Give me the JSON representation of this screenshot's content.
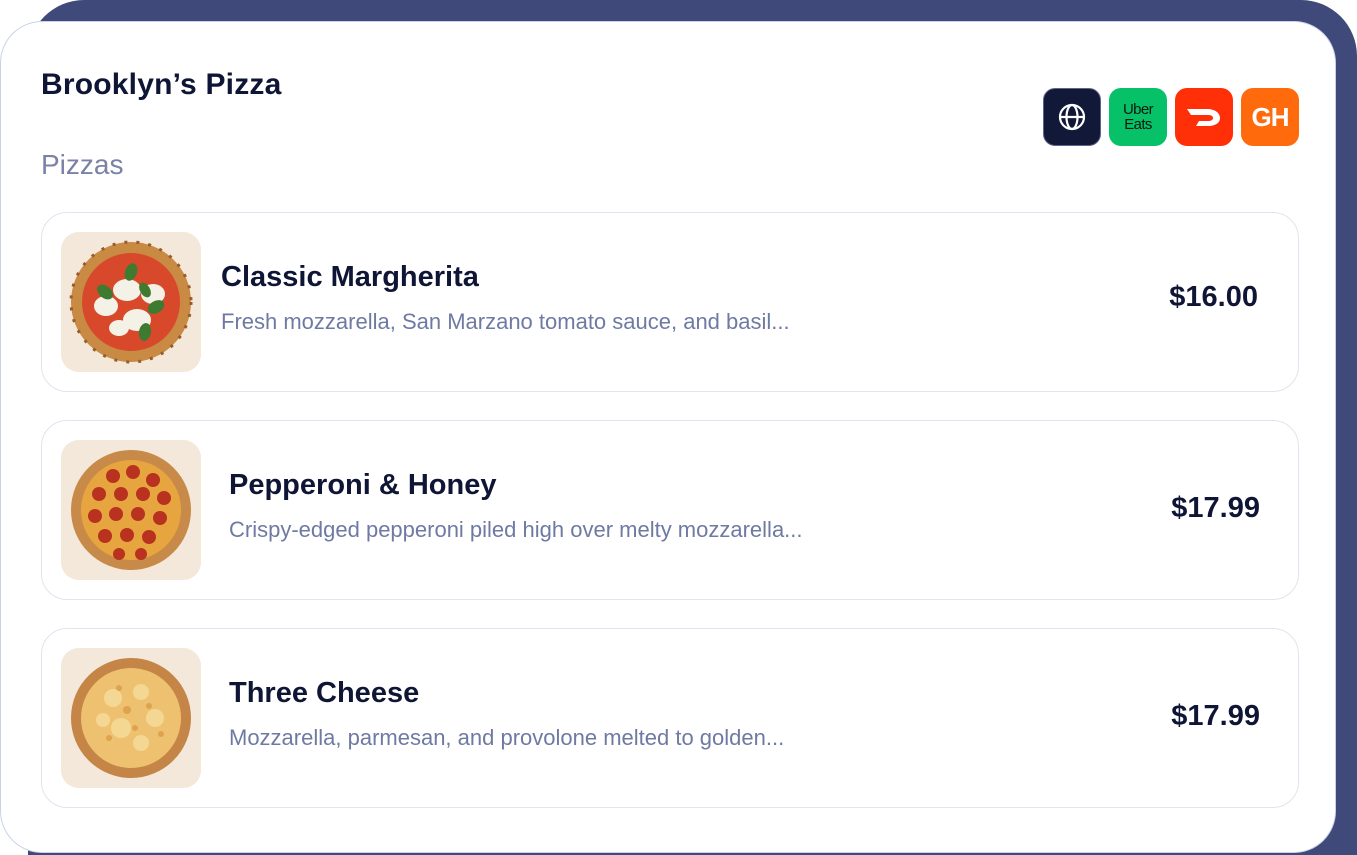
{
  "restaurant": {
    "name": "Brooklyn’s Pizza"
  },
  "category": "Pizzas",
  "links": [
    {
      "label": "",
      "icon": "globe-icon"
    },
    {
      "label_line1": "Uber",
      "label_line2": "Eats",
      "icon": "uber-eats-icon"
    },
    {
      "label": "",
      "icon": "doordash-icon"
    },
    {
      "label": "GH",
      "icon": "grubhub-icon"
    }
  ],
  "items": [
    {
      "name": "Classic Margherita",
      "description": "Fresh mozzarella, San Marzano tomato sauce, and basil...",
      "price": "$16.00",
      "image": "margherita-pizza-image"
    },
    {
      "name": "Pepperoni & Honey",
      "description": "Crispy-edged pepperoni piled high over melty mozzarella...",
      "price": "$17.99",
      "image": "pepperoni-pizza-image"
    },
    {
      "name": "Three Cheese",
      "description": "Mozzarella, parmesan, and provolone melted to golden...",
      "price": "$17.99",
      "image": "cheese-pizza-image"
    }
  ],
  "colors": {
    "backdrop": "#3f4a7a",
    "title": "#0f1535",
    "muted": "#7a82a6",
    "uber_eats": "#06c167",
    "doordash": "#ff3008",
    "grubhub": "#ff6a0d"
  }
}
